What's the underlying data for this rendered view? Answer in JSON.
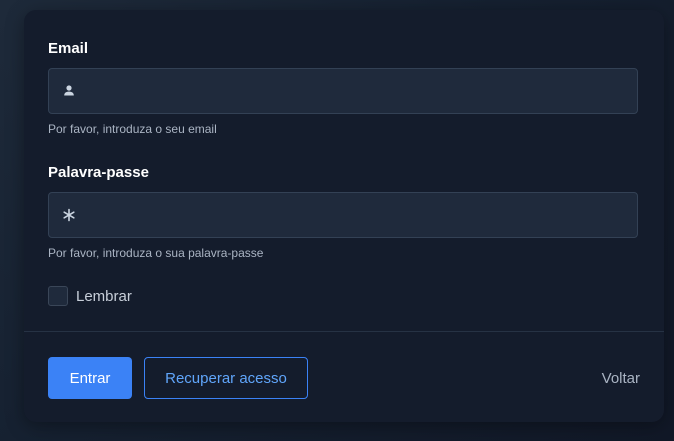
{
  "form": {
    "email": {
      "label": "Email",
      "value": "",
      "placeholder": "",
      "help": "Por favor, introduza o seu email",
      "icon": "user-icon"
    },
    "password": {
      "label": "Palavra-passe",
      "value": "",
      "placeholder": "",
      "help": "Por favor, introduza o sua palavra-passe",
      "icon": "asterisk-icon"
    },
    "remember": {
      "label": "Lembrar",
      "checked": false
    }
  },
  "actions": {
    "login_label": "Entrar",
    "recover_label": "Recuperar acesso",
    "back_label": "Voltar"
  },
  "colors": {
    "accent": "#3b82f6",
    "card": "#141c2c",
    "input": "#1f2a3c"
  }
}
